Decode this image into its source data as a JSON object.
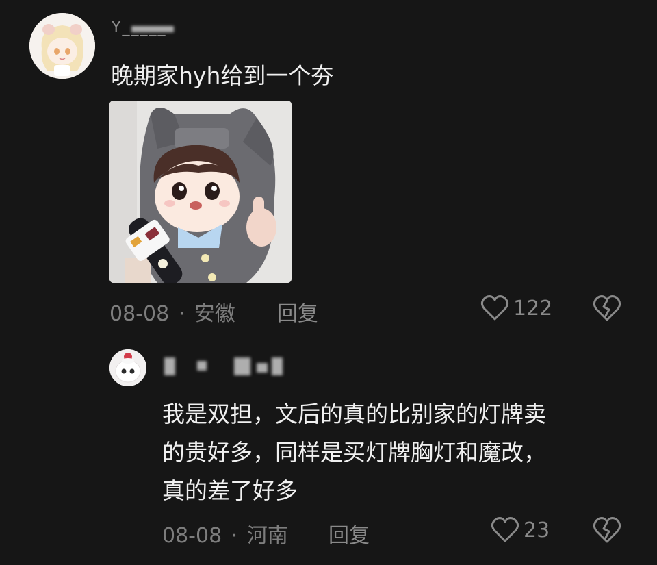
{
  "comment1": {
    "username": "Y_____",
    "text": "晚期家hyh给到一个夯",
    "date": "08-08",
    "separator": "·",
    "location": "安徽",
    "reply_label": "回复",
    "like_count": "122"
  },
  "reply1": {
    "username": "",
    "text_lines": [
      "我是双担，文后的真的比别家的灯牌卖",
      "的贵好多，同样是买灯牌胸灯和魔改，",
      "真的差了好多"
    ],
    "date": "08-08",
    "separator": "·",
    "location": "河南",
    "reply_label": "回复",
    "like_count": "23"
  },
  "colors": {
    "background": "#161616",
    "text_primary": "#f0f0f0",
    "text_secondary": "#7d7d7d"
  }
}
